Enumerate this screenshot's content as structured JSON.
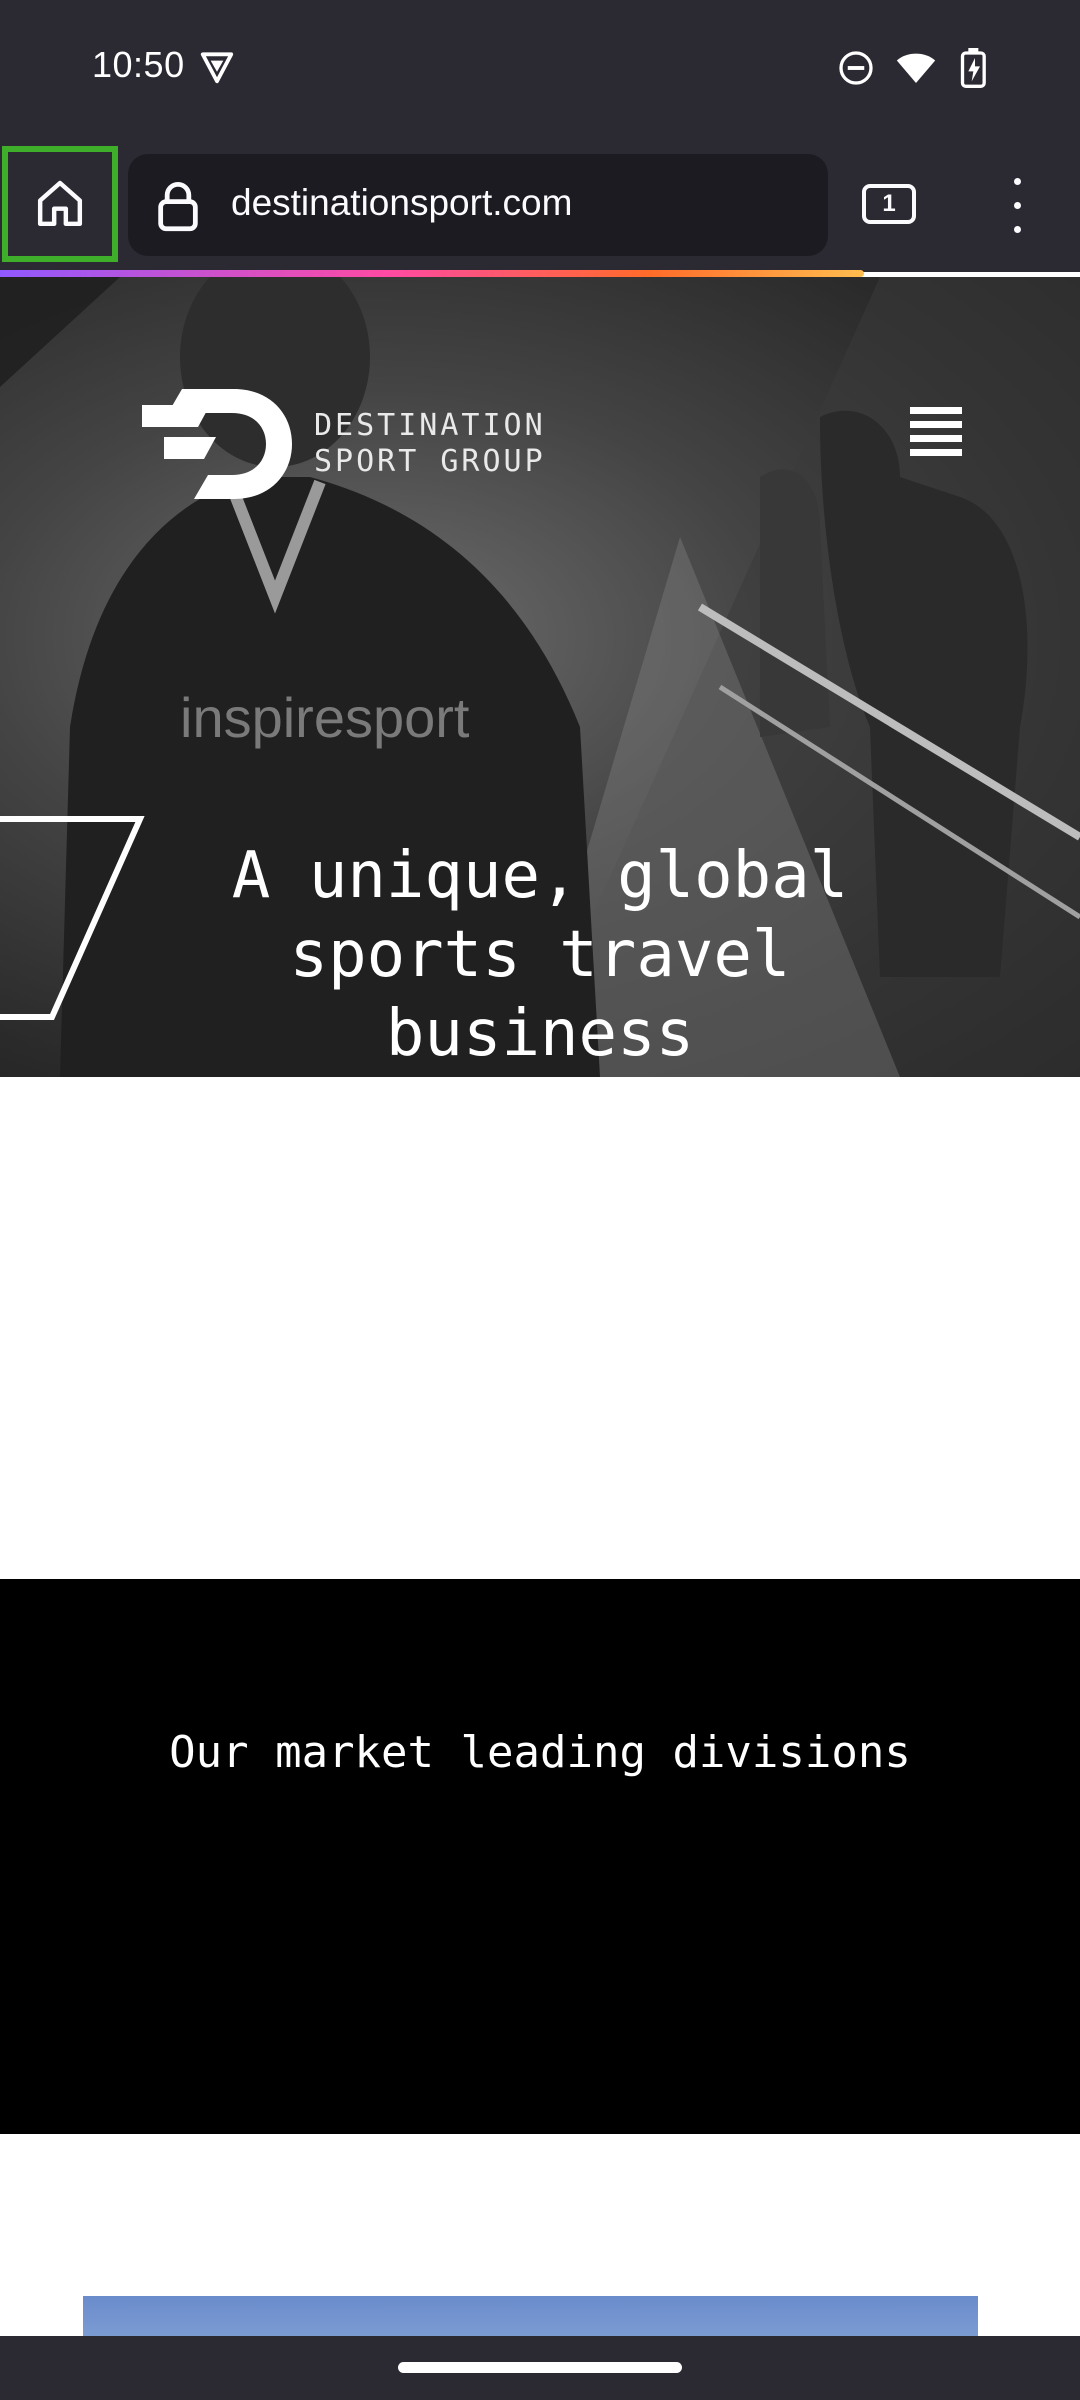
{
  "status_bar": {
    "time": "10:50",
    "left_icon": "vpn-shield-icon",
    "icons": [
      "do-not-disturb-icon",
      "wifi-icon",
      "battery-charging-icon"
    ]
  },
  "browser": {
    "home_icon": "home-icon",
    "url": "destinationsport.com",
    "tab_count": "1",
    "menu_icon": "more-vert-icon",
    "accent_colors": {
      "toolbar": "#2b2a33",
      "url_field": "#1c1b22",
      "home_highlight": "#3fae2a"
    }
  },
  "hero": {
    "logo_line1": "DESTINATION",
    "logo_line2": "SPORT GROUP",
    "menu_icon": "hamburger-menu-icon",
    "title": "A unique, global sports travel business"
  },
  "divisions": {
    "heading": "Our market leading divisions"
  }
}
